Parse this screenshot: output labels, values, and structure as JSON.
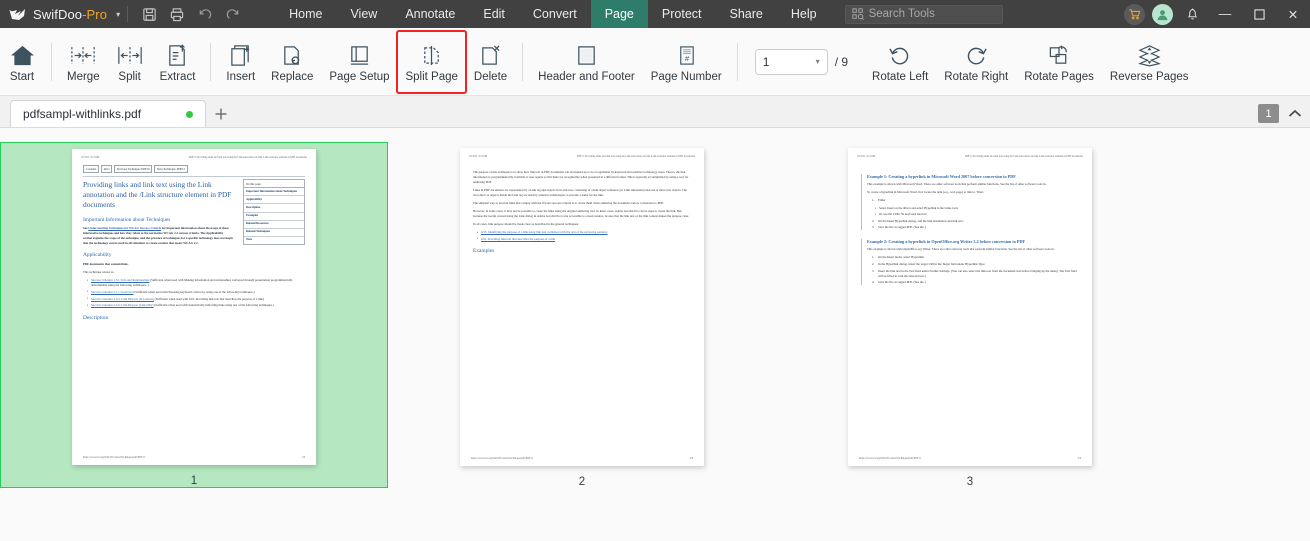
{
  "app": {
    "brand_name": "SwifDoo",
    "brand_suffix": "-Pro",
    "caret": "▾"
  },
  "quick_access": [
    {
      "name": "save-icon",
      "label": "Save"
    },
    {
      "name": "print-icon",
      "label": "Print"
    },
    {
      "name": "undo-icon",
      "label": "Undo"
    },
    {
      "name": "redo-icon",
      "label": "Redo"
    }
  ],
  "menu": {
    "items": [
      {
        "label": "Home",
        "active": false
      },
      {
        "label": "View",
        "active": false
      },
      {
        "label": "Annotate",
        "active": false
      },
      {
        "label": "Edit",
        "active": false
      },
      {
        "label": "Convert",
        "active": false
      },
      {
        "label": "Page",
        "active": true
      },
      {
        "label": "Protect",
        "active": false
      },
      {
        "label": "Share",
        "active": false
      },
      {
        "label": "Help",
        "active": false
      }
    ],
    "active_color": "#2e7d6b"
  },
  "search": {
    "placeholder": "Search Tools",
    "icon": "search-tools-icon"
  },
  "titlebar_right": {
    "cart": "cart-icon",
    "account": "user-avatar-icon",
    "notifications": "bell-icon",
    "minimize": "—",
    "maximize": "☐",
    "close": "✕"
  },
  "ribbon": {
    "groups": [
      {
        "items": [
          {
            "label": "Start",
            "icon": "home-icon"
          }
        ]
      },
      {
        "items": [
          {
            "label": "Merge",
            "icon": "merge-icon"
          },
          {
            "label": "Split",
            "icon": "split-icon"
          },
          {
            "label": "Extract",
            "icon": "extract-icon"
          }
        ]
      },
      {
        "items": [
          {
            "label": "Insert",
            "icon": "insert-page-icon"
          },
          {
            "label": "Replace",
            "icon": "replace-page-icon"
          },
          {
            "label": "Page Setup",
            "icon": "page-setup-icon"
          },
          {
            "label": "Split Page",
            "icon": "split-page-icon",
            "highlighted": true
          },
          {
            "label": "Delete",
            "icon": "delete-page-icon"
          }
        ]
      },
      {
        "items": [
          {
            "label": "Header and Footer",
            "icon": "header-footer-icon"
          },
          {
            "label": "Page Number",
            "icon": "page-number-icon"
          }
        ]
      }
    ],
    "page_nav": {
      "value": "1",
      "caret": "▾",
      "total": "/ 9"
    },
    "rotate": [
      {
        "label": "Rotate Left",
        "icon": "rotate-left-icon"
      },
      {
        "label": "Rotate Right",
        "icon": "rotate-right-icon"
      },
      {
        "label": "Rotate Pages",
        "icon": "rotate-pages-icon"
      },
      {
        "label": "Reverse Pages",
        "icon": "reverse-pages-icon"
      }
    ],
    "highlight_color": "#f4231f"
  },
  "tabstrip": {
    "document_tab": {
      "title": "pdfsampl-withlinks.pdf",
      "modified_dot_color": "#36c93c"
    },
    "new_tab_icon": "plus-icon",
    "page_badge": "1",
    "collapse_icon": "chevron-up-icon"
  },
  "thumbnails": {
    "selection_fill": "#b5e8c0",
    "selection_border": "#25cf57",
    "pages": [
      {
        "number": "1",
        "selected": true
      },
      {
        "number": "2",
        "selected": false
      },
      {
        "number": "3",
        "selected": false
      }
    ]
  },
  "document": {
    "header_date": "10/3/22, 3:21 PM",
    "header_title": "PDF11: Providing links and link text using the Link annotation and the /Link structure element in PDF documents",
    "footer_url": "https://www.w3.org/WAI/WCAG22/Techniques/pdf/PDF11",
    "page1": {
      "nav_chips": [
        "Contents",
        "Intro",
        "Previous Technique: PDF10",
        "Next Technique: PDF12"
      ],
      "title": "Providing links and link text using the Link annotation and the /Link structure element in PDF documents",
      "toc_header": "On this page:",
      "toc_items": [
        "Important Information about Techniques",
        "Applicability",
        "Description",
        "Examples",
        "Related Resources",
        "Related Techniques",
        "Tests"
      ],
      "h2_info": "Important Information about Techniques",
      "info_text_pre": "See ",
      "info_link": "Understanding Techniques for WCAG Success Criteria",
      "info_text_post": " for important information about the usage of these informative techniques and how they relate to the normative WCAG 2.2 success criteria. The Applicability section explains the scope of the technique, and the presence of techniques for a specific technology does not imply that the technology can be used in all situations to create content that meets WCAG 2.2.",
      "h2_applicability": "Applicability",
      "applicability_text": "PDF documents that contain links.",
      "relates_text": "This technique relates to:",
      "criteria": [
        {
          "link": "Success Criterion 1.3.1: Info and Relationships",
          "text": " (Sufficient when used with Making information and relationships conveyed through presentation programmatically determinable using the following techniques: )"
        },
        {
          "link": "Success Criterion 2.1.1: Keyboard",
          "text": " (Sufficient when used with Ensuring keyboard control by using one of the following techniques.)"
        },
        {
          "link": "Success Criterion 2.4.4: Link Purpose (In Context)",
          "text": " (Sufficient when used with G91: Providing link text that describes the purpose of a link)"
        },
        {
          "link": "Success Criterion 2.4.9: Link Purpose (Link Only)",
          "text": " (Sufficient when used with Semantically indicating links using one of the following techniques.)"
        }
      ],
      "h2_description": "Description",
      "footer_page": "1/9"
    },
    "page2": {
      "paragraphs": [
        "The purpose of this technique is to show how link text in PDF documents can be marked up to be recognizable by keyboard and assistive technology users. That is, the link information is programmatically available to user agents so that links are recognizable when presented in a different format. This is typically accomplished by using a tool for authoring PDF.",
        "Links in PDF documents are represented by a Link tag and objects in its sub-tree, consisting of a link object reference (or Link annotation) and one or more text objects. The text object or objects inside the Link tag are used by assistive technologies to provide a name for the link.",
        "The simplest way to provide links that comply with the WCAG success criteria is to create them when authoring the document, before conversion to PDF.",
        "However, in some cases, it may not be possible to create the links using the original authoring tool. In these cases, Adobe Acrobat Pro can be used to create the link. But, because the tooltip created using the Link dialog in Adobe Acrobat Pro is not accessible to screen readers, be sure that the link text or the link context makes the purpose clear.",
        "In all cases, link purpose should be made clear as described in the general techniques:"
      ],
      "bullets": [
        "G53: Identifying the purpose of a link using link text combined with the text of the enclosing sentence",
        "G91: Providing link text that describes the purpose of a link"
      ],
      "h2_examples": "Examples",
      "footer_page": "2/9"
    },
    "page3": {
      "example1": {
        "heading": "Example 1: Creating a hyperlink in Microsoft Word 2007 before conversion to PDF",
        "intro": "This example is shown with Microsoft Word. There are other software tools that perform similar functions. See the list of other software tools in .",
        "lead": "To create a hyperlink in Microsoft Word, first locate the item (e.g., web page) to link to. Then:",
        "steps": [
          "Either",
          "On the Insert Hyperlink dialog, add the link destination and link text.",
          "Save the file as tagged PDF. (See the .)"
        ],
        "substeps": [
          "Select Insert on the ribbon and select Hyperlink in the Links tools",
          "Or, use the CTRL+K keyboard shortcut"
        ]
      },
      "example2": {
        "heading": "Example 2: Creating a hyperlink in OpenOffice.org Writer 2.2 before conversion to PDF",
        "intro": "This example is shown with OpenOffice.org Writer. There are other software tools that perform similar functions. See the list of other software tools in .",
        "steps": [
          "On the Insert menu, select Hyperlink.",
          "In the Hyperlink dialog, insert the target URI in the Target field under Hyperlink Type.",
          "Insert the link text in the Text field under Further Settings. (You can also select the link text from the document text before bringing up the dialog. The Text field will be filled in with the selected text.)",
          "Save the file as tagged PDF. (See the .)"
        ]
      },
      "footer_page": "3/9"
    }
  }
}
